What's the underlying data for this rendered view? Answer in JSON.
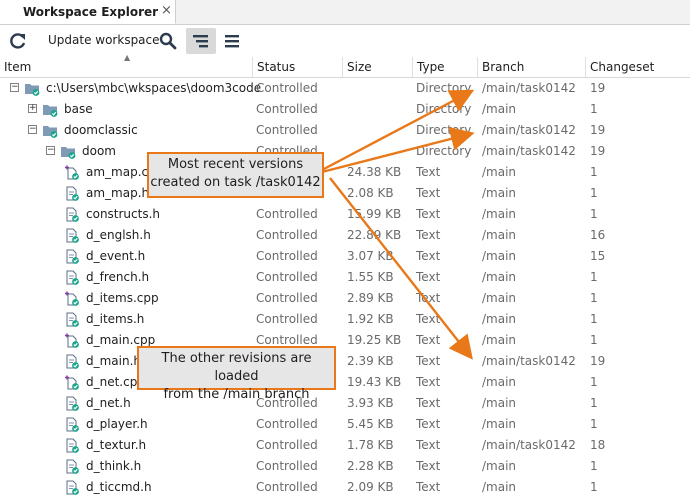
{
  "tab": {
    "title": "Workspace Explorer",
    "close": "×"
  },
  "toolbar": {
    "update_label": "Update workspace"
  },
  "columns": [
    "Item",
    "Status",
    "Size",
    "Type",
    "Branch",
    "Changeset"
  ],
  "rows": [
    {
      "level": 0,
      "expander": "minus",
      "icon": "folder",
      "name": "c:\\Users\\mbc\\wkspaces\\doom3code",
      "status": "Controlled",
      "size": "",
      "type": "Directory",
      "branch": "/main/task0142",
      "changeset": "19"
    },
    {
      "level": 1,
      "expander": "plus",
      "icon": "folder",
      "name": "base",
      "status": "Controlled",
      "size": "",
      "type": "Directory",
      "branch": "/main",
      "changeset": "1"
    },
    {
      "level": 1,
      "expander": "minus",
      "icon": "folder",
      "name": "doomclassic",
      "status": "Controlled",
      "size": "",
      "type": "Directory",
      "branch": "/main/task0142",
      "changeset": "19"
    },
    {
      "level": 2,
      "expander": "minus",
      "icon": "folder",
      "name": "doom",
      "status": "Controlled",
      "size": "",
      "type": "Directory",
      "branch": "/main/task0142",
      "changeset": "19"
    },
    {
      "level": 3,
      "expander": "",
      "icon": "file-plus",
      "name": "am_map.cpp",
      "status": "Controlled",
      "size": "24.38 KB",
      "type": "Text",
      "branch": "/main",
      "changeset": "1"
    },
    {
      "level": 3,
      "expander": "",
      "icon": "file",
      "name": "am_map.h",
      "status": "Controlled",
      "size": "2.08 KB",
      "type": "Text",
      "branch": "/main",
      "changeset": "1"
    },
    {
      "level": 3,
      "expander": "",
      "icon": "file",
      "name": "constructs.h",
      "status": "Controlled",
      "size": "15.99 KB",
      "type": "Text",
      "branch": "/main",
      "changeset": "1"
    },
    {
      "level": 3,
      "expander": "",
      "icon": "file",
      "name": "d_englsh.h",
      "status": "Controlled",
      "size": "22.89 KB",
      "type": "Text",
      "branch": "/main",
      "changeset": "16"
    },
    {
      "level": 3,
      "expander": "",
      "icon": "file",
      "name": "d_event.h",
      "status": "Controlled",
      "size": "3.07 KB",
      "type": "Text",
      "branch": "/main",
      "changeset": "15"
    },
    {
      "level": 3,
      "expander": "",
      "icon": "file",
      "name": "d_french.h",
      "status": "Controlled",
      "size": "1.55 KB",
      "type": "Text",
      "branch": "/main",
      "changeset": "1"
    },
    {
      "level": 3,
      "expander": "",
      "icon": "file-plus",
      "name": "d_items.cpp",
      "status": "Controlled",
      "size": "2.89 KB",
      "type": "Text",
      "branch": "/main",
      "changeset": "1"
    },
    {
      "level": 3,
      "expander": "",
      "icon": "file",
      "name": "d_items.h",
      "status": "Controlled",
      "size": "1.92 KB",
      "type": "Text",
      "branch": "/main",
      "changeset": "1"
    },
    {
      "level": 3,
      "expander": "",
      "icon": "file-plus",
      "name": "d_main.cpp",
      "status": "Controlled",
      "size": "19.25 KB",
      "type": "Text",
      "branch": "/main",
      "changeset": "1"
    },
    {
      "level": 3,
      "expander": "",
      "icon": "file",
      "name": "d_main.h",
      "status": "Controlled",
      "size": "2.39 KB",
      "type": "Text",
      "branch": "/main/task0142",
      "changeset": "19"
    },
    {
      "level": 3,
      "expander": "",
      "icon": "file-plus",
      "name": "d_net.cpp",
      "status": "Controlled",
      "size": "19.43 KB",
      "type": "Text",
      "branch": "/main",
      "changeset": "1"
    },
    {
      "level": 3,
      "expander": "",
      "icon": "file",
      "name": "d_net.h",
      "status": "Controlled",
      "size": "3.93 KB",
      "type": "Text",
      "branch": "/main",
      "changeset": "1"
    },
    {
      "level": 3,
      "expander": "",
      "icon": "file",
      "name": "d_player.h",
      "status": "Controlled",
      "size": "5.45 KB",
      "type": "Text",
      "branch": "/main",
      "changeset": "1"
    },
    {
      "level": 3,
      "expander": "",
      "icon": "file",
      "name": "d_textur.h",
      "status": "Controlled",
      "size": "1.78 KB",
      "type": "Text",
      "branch": "/main/task0142",
      "changeset": "18"
    },
    {
      "level": 3,
      "expander": "",
      "icon": "file",
      "name": "d_think.h",
      "status": "Controlled",
      "size": "2.28 KB",
      "type": "Text",
      "branch": "/main",
      "changeset": "1"
    },
    {
      "level": 3,
      "expander": "",
      "icon": "file",
      "name": "d_ticcmd.h",
      "status": "Controlled",
      "size": "2.09 KB",
      "type": "Text",
      "branch": "/main",
      "changeset": "1"
    }
  ],
  "callouts": {
    "recent": "Most recent versions\ncreated on task /task0142",
    "others": "The other revisions are loaded\nfrom the /main branch"
  },
  "colors": {
    "callout_border": "#e87818",
    "arrow": "#e87818",
    "folder": "#7f9ab5",
    "check": "#1aa58c"
  },
  "icons": [
    "refresh-icon",
    "search-icon",
    "tree-view-icon",
    "menu-icon",
    "close-icon",
    "folder-icon",
    "file-icon",
    "checkmark-icon"
  ]
}
